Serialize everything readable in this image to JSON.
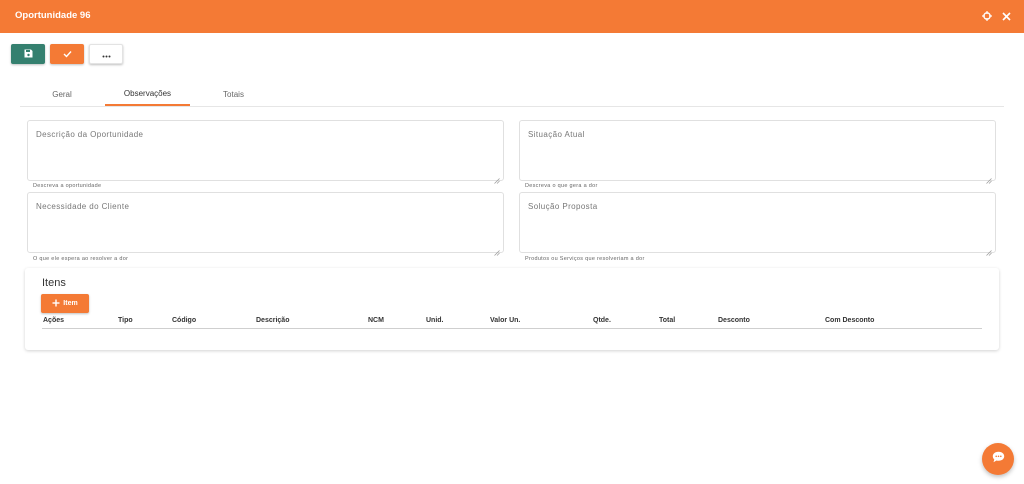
{
  "header": {
    "title": "Oportunidade 96",
    "bg_color": "#f47a35",
    "icons": [
      "target-icon",
      "close-icon"
    ]
  },
  "toolbar": {
    "buttons": [
      {
        "icon": "save-icon",
        "color": "#35806f"
      },
      {
        "icon": "check-icon",
        "color": "#f47a35"
      },
      {
        "icon": "more-icon",
        "color": "#ffffff"
      }
    ]
  },
  "tabs": {
    "items": [
      "Geral",
      "Observações",
      "Totais"
    ],
    "active": "Observações"
  },
  "fields": {
    "descricao": {
      "placeholder": "Descrição da Oportunidade",
      "hint": "Descreva a oportunidade"
    },
    "situacao": {
      "placeholder": "Situação Atual",
      "hint": "Descreva o que gera a dor"
    },
    "necessidade": {
      "placeholder": "Necessidade do Cliente",
      "hint": "O que ele espera ao resolver a dor"
    },
    "solucao": {
      "placeholder": "Solução Proposta",
      "hint": "Produtos ou Serviços que resolveriam a dor"
    }
  },
  "itens": {
    "title": "Itens",
    "add_label": "Item",
    "columns": [
      "Ações",
      "Tipo",
      "Código",
      "Descrição",
      "NCM",
      "Unid.",
      "Valor Un.",
      "Qtde.",
      "Total",
      "Desconto",
      "Com Desconto"
    ],
    "rows": []
  },
  "fab": {
    "icon": "chat-icon"
  }
}
